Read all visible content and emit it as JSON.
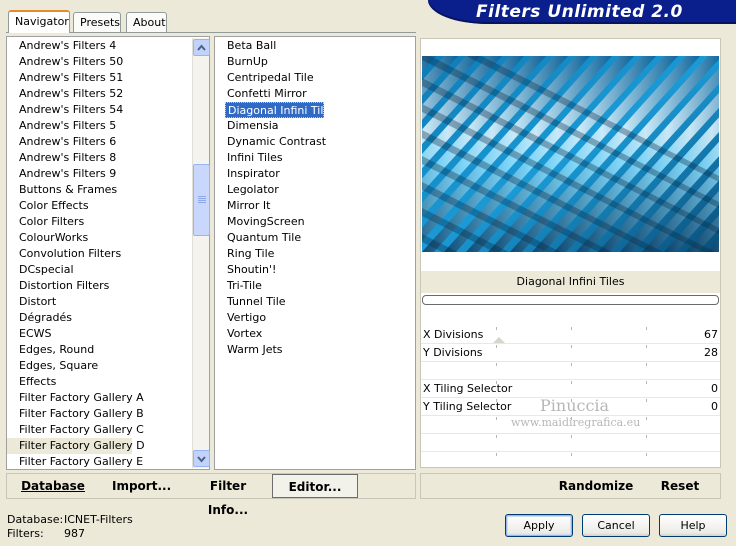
{
  "tabs": [
    {
      "label": "Navigator",
      "active": true
    },
    {
      "label": "Presets",
      "active": false
    },
    {
      "label": "About",
      "active": false
    }
  ],
  "banner": {
    "title": "Filters Unlimited 2.0",
    "color": "#0a1f8c"
  },
  "categories": [
    "Andrew's Filters 4",
    "Andrew's Filters 50",
    "Andrew's Filters 51",
    "Andrew's Filters 52",
    "Andrew's Filters 54",
    "Andrew's Filters 5",
    "Andrew's Filters 6",
    "Andrew's Filters 8",
    "Andrew's Filters 9",
    "Buttons & Frames",
    "Color Effects",
    "Color Filters",
    "ColourWorks",
    "Convolution Filters",
    "DCspecial",
    "Distortion Filters",
    "Distort",
    "Dégradés",
    "ECWS",
    "Edges, Round",
    "Edges, Square",
    "Effects",
    "Filter Factory Gallery A",
    "Filter Factory Gallery B",
    "Filter Factory Gallery C",
    "Filter Factory Gallery D",
    "Filter Factory Gallery E"
  ],
  "selected_category": "Filter Factory Gallery D",
  "filters": [
    "Beta Ball",
    "BurnUp",
    "Centripedal Tile",
    "Confetti Mirror",
    "Diagonal Infini Tiles",
    "Dimensia",
    "Dynamic Contrast",
    "Infini Tiles",
    "Inspirator",
    "Legolator",
    "Mirror It",
    "MovingScreen",
    "Quantum Tile",
    "Ring Tile",
    "Shoutin'!",
    "Tri-Tile",
    "Tunnel Tile",
    "Vertigo",
    "Vortex",
    "Warm Jets"
  ],
  "selected_filter": "Diagonal Infini Tiles",
  "filter_title": "Diagonal Infini Tiles",
  "parameters": [
    {
      "label": "X Divisions",
      "value": "67"
    },
    {
      "label": "Y Divisions",
      "value": "28"
    },
    {
      "label": "",
      "value": ""
    },
    {
      "label": "X Tiling Selector",
      "value": "0"
    },
    {
      "label": "Y Tiling Selector",
      "value": "0"
    }
  ],
  "watermark": {
    "name": "Pinuccia",
    "url": "www.maidiregrafica.eu"
  },
  "bottom_bar": {
    "database": "Database",
    "import": "Import...",
    "filter_info": "Filter Info...",
    "editor": "Editor...",
    "randomize": "Randomize",
    "reset": "Reset"
  },
  "status": {
    "database_label": "Database:",
    "database_value": "ICNET-Filters",
    "filters_label": "Filters:",
    "filters_value": "987"
  },
  "buttons": {
    "apply": "Apply",
    "cancel": "Cancel",
    "help": "Help"
  }
}
